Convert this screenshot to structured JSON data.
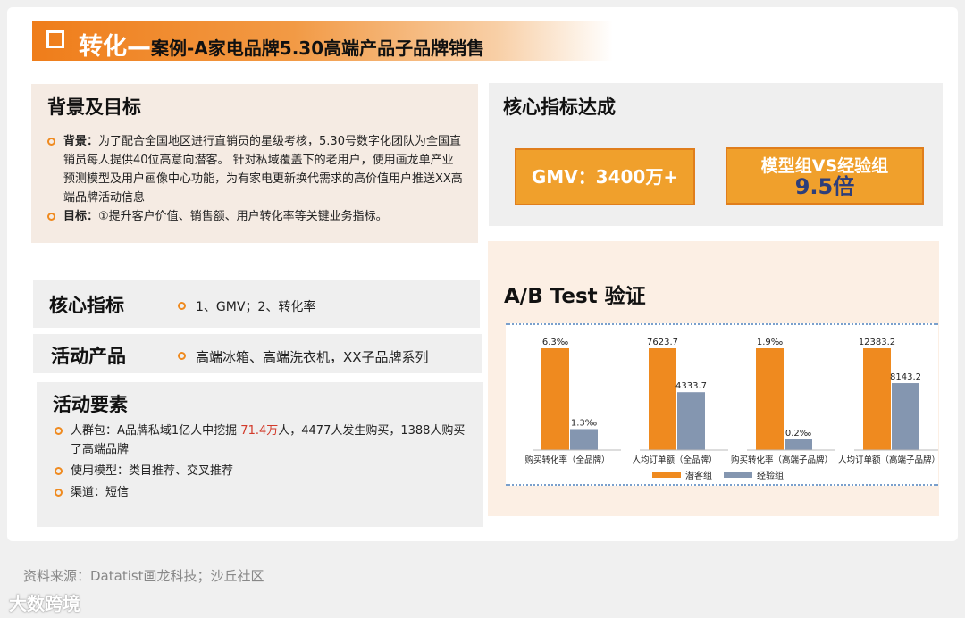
{
  "title": {
    "main": "转化—",
    "sub": "案例-A家电品牌5.30高端产品子品牌销售"
  },
  "background_panel": {
    "heading": "背景及目标",
    "items": [
      {
        "label": "背景：",
        "text": "为了配合全国地区进行直销员的星级考核，5.30号数字化团队为全国直销员每人提供40位高意向潜客。 针对私域覆盖下的老用户，使用画龙单产业预测模型及用户画像中心功能，为有家电更新换代需求的高价值用户推送XX高端品牌活动信息"
      },
      {
        "label": "目标：",
        "text": "①提升客户价值、销售额、用户转化率等关键业务指标。"
      }
    ]
  },
  "core_metric": {
    "heading": "核心指标",
    "text": "1、GMV；2、转化率"
  },
  "activity_product": {
    "heading": "活动产品",
    "text": "高端冰箱、高端洗衣机，XX子品牌系列"
  },
  "activity_elements": {
    "heading": "活动要素",
    "crowd_prefix": "人群包：A品牌私域1亿人中挖掘 ",
    "crowd_highlight": "71.4万",
    "crowd_suffix": "人，4477人发生购买，1388人购买了高端品牌",
    "model": "使用模型：类目推荐、交叉推荐",
    "channel": "渠道：短信"
  },
  "kpi": {
    "heading": "核心指标达成",
    "gmv": "GMV：3400万+",
    "compare_label": "模型组VS经验组",
    "compare_value": "9.5倍"
  },
  "ab_test": {
    "heading": "A/B Test 验证"
  },
  "chart_data": {
    "type": "bar",
    "categories": [
      "购买转化率（全品牌）",
      "人均订单额（全品牌）",
      "购买转化率（高端子品牌）",
      "人均订单额（高端子品牌）"
    ],
    "series": [
      {
        "name": "潜客组",
        "values": [
          6.3,
          7623.7,
          1.9,
          12383.2
        ],
        "labels": [
          "6.3‰",
          "7623.7",
          "1.9‰",
          "12383.2"
        ],
        "color": "#ef8a1f"
      },
      {
        "name": "经验组",
        "values": [
          1.3,
          4333.7,
          0.2,
          8143.2
        ],
        "labels": [
          "1.3‰",
          "4333.7",
          "0.2‰",
          "8143.2"
        ],
        "color": "#8496b0"
      }
    ],
    "legend": "bottom"
  },
  "source": "资料来源：Datatist画龙科技；沙丘社区",
  "watermark": "大数跨境"
}
